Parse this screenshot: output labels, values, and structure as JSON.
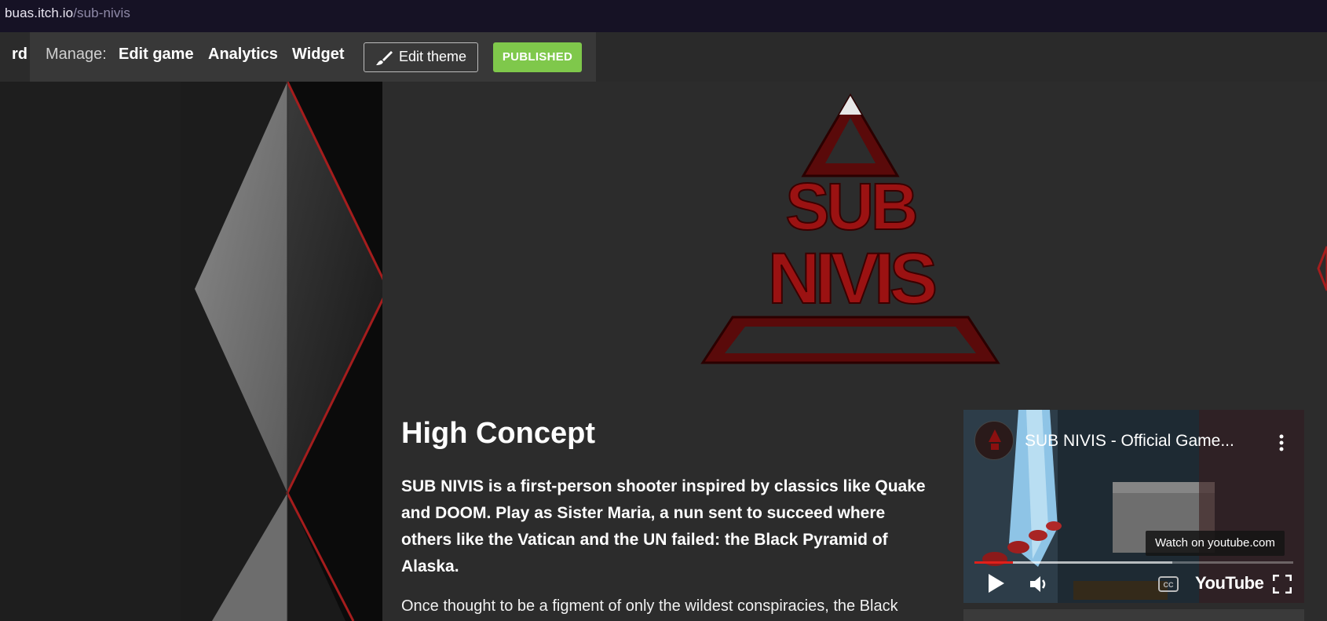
{
  "browser": {
    "url_domain": "buas.itch.io",
    "url_path": "/sub-nivis"
  },
  "manage_bar": {
    "dashboard_partial": "rd",
    "label": "Manage:",
    "links": [
      "Edit game",
      "Analytics",
      "Widget"
    ],
    "edit_theme": "Edit theme",
    "status": "PUBLISHED"
  },
  "logo": {
    "line1": "SUB",
    "line2": "NIVIS"
  },
  "content": {
    "heading": "High Concept",
    "lead": "SUB NIVIS is a first-person shooter inspired by classics like Quake and DOOM. Play as Sister Maria, a nun sent to succeed where others like the Vatican and the UN failed: the Black Pyramid of Alaska.",
    "body": "Once thought to be a figment of only the wildest conspiracies, the Black"
  },
  "video": {
    "title": "SUB NIVIS - Official Game...",
    "watch_on": "Watch on youtube.com",
    "brand": "YouTube",
    "progress": 0.62,
    "buffered": 0.12
  },
  "colors": {
    "urlbar": "#161225",
    "manage_bar": "#383838",
    "published": "#7fc84b",
    "accent_red": "#8b1010"
  }
}
